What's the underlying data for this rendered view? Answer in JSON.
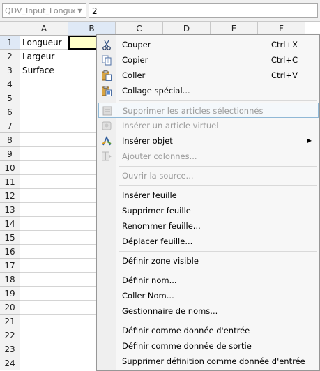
{
  "formula_bar": {
    "name_box": "QDV_Input_Longueur",
    "formula": "2"
  },
  "columns": [
    "A",
    "B",
    "C",
    "D",
    "E",
    "F"
  ],
  "rows": [
    "1",
    "2",
    "3",
    "4",
    "5",
    "6",
    "7",
    "8",
    "9",
    "10",
    "11",
    "12",
    "13",
    "14",
    "15",
    "16",
    "17",
    "18",
    "19",
    "20",
    "21",
    "22",
    "23",
    "24"
  ],
  "cells": {
    "A1": "Longueur",
    "A2": "Largeur",
    "A3": "Surface"
  },
  "colors": {
    "active_cell": "#ffffc8",
    "selected_header": "#dfe9f6",
    "menu_highlight_border": "#8fb8d6",
    "disabled_text": "#9b9b9b"
  },
  "context_menu": {
    "cut": {
      "label": "Couper",
      "shortcut": "Ctrl+X",
      "icon": "scissors-icon"
    },
    "copy": {
      "label": "Copier",
      "shortcut": "Ctrl+C",
      "icon": "copy-icon"
    },
    "paste": {
      "label": "Coller",
      "shortcut": "Ctrl+V",
      "icon": "paste-icon"
    },
    "paste_special": {
      "label": "Collage spécial...",
      "icon": "paste-special-icon"
    },
    "delete_selected": {
      "label": "Supprimer les articles sélectionnés",
      "icon": "delete-items-icon"
    },
    "insert_virtual": {
      "label": "Insérer un article virtuel",
      "icon": "virtual-item-icon"
    },
    "insert_object": {
      "label": "Insérer objet",
      "icon": "insert-object-icon"
    },
    "add_columns": {
      "label": "Ajouter colonnes...",
      "icon": "add-columns-icon"
    },
    "open_source": {
      "label": "Ouvrir la source..."
    },
    "insert_sheet": {
      "label": "Insérer feuille"
    },
    "delete_sheet": {
      "label": "Supprimer feuille"
    },
    "rename_sheet": {
      "label": "Renommer feuille..."
    },
    "move_sheet": {
      "label": "Déplacer feuille..."
    },
    "define_visible": {
      "label": "Définir zone visible"
    },
    "define_name": {
      "label": "Définir nom..."
    },
    "paste_name": {
      "label": "Coller Nom..."
    },
    "name_manager": {
      "label": "Gestionnaire de noms..."
    },
    "define_input": {
      "label": "Définir comme donnée d'entrée"
    },
    "define_output": {
      "label": "Définir comme donnée de sortie"
    },
    "remove_input": {
      "label": "Supprimer définition comme donnée d'entrée"
    }
  }
}
